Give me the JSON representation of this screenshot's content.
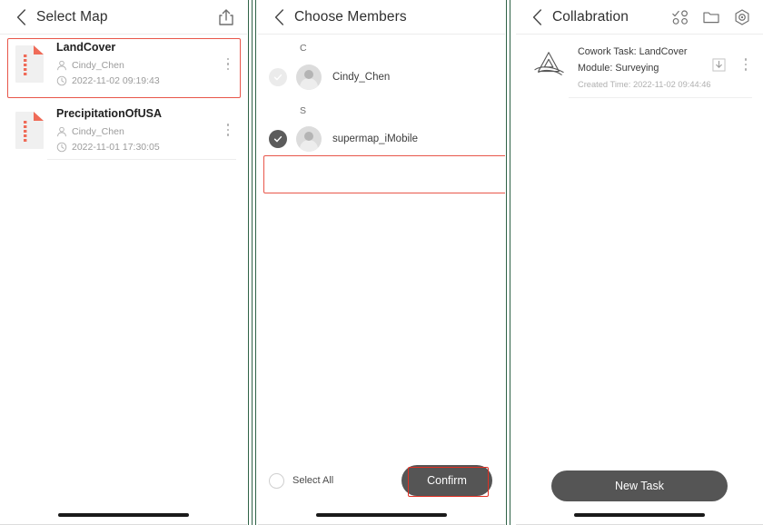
{
  "panel_select_map": {
    "header": {
      "back_icon": "chevron-left-icon",
      "title": "Select Map",
      "share_icon": "share-icon"
    },
    "maps": [
      {
        "name": "LandCover",
        "owner": "Cindy_Chen",
        "time": "2022-11-02 09:19:43",
        "file_icon": "zip-file-icon",
        "owner_icon": "person-icon",
        "time_icon": "clock-icon",
        "menu_icon": "more-vertical-icon",
        "highlighted": true
      },
      {
        "name": "PrecipitationOfUSA",
        "owner": "Cindy_Chen",
        "time": "2022-11-01 17:30:05",
        "file_icon": "zip-file-icon",
        "owner_icon": "person-icon",
        "time_icon": "clock-icon",
        "menu_icon": "more-vertical-icon",
        "highlighted": false
      }
    ]
  },
  "panel_choose_members": {
    "header": {
      "back_icon": "chevron-left-icon",
      "title": "Choose Members"
    },
    "sections": [
      {
        "letter": "C",
        "members": [
          {
            "name": "Cindy_Chen",
            "checked": false,
            "avatar_icon": "avatar-icon",
            "checkbox_icon": "check-circle-icon"
          }
        ]
      },
      {
        "letter": "S",
        "members": [
          {
            "name": "supermap_iMobile",
            "checked": true,
            "avatar_icon": "avatar-icon",
            "checkbox_icon": "check-circle-icon"
          }
        ]
      }
    ],
    "footer": {
      "select_all_label": "Select All",
      "select_all_checked": false,
      "confirm_label": "Confirm"
    }
  },
  "panel_collaboration": {
    "header": {
      "back_icon": "chevron-left-icon",
      "title": "Collabration",
      "actions": [
        "task-grid-icon",
        "folder-icon",
        "hex-settings-icon"
      ]
    },
    "tasks": [
      {
        "logo_icon": "mountain-logo-icon",
        "task_line": "Cowork Task: LandCover",
        "module_line": "Module: Surveying",
        "created_time": "Created Time: 2022-11-02 09:44:46",
        "download_icon": "download-icon",
        "menu_icon": "more-vertical-icon"
      }
    ],
    "footer": {
      "new_task_label": "New Task"
    }
  },
  "colors": {
    "highlight_red": "#e8564a",
    "confirm_highlight_red": "#e02f22",
    "button_dark": "#555555",
    "divider_green": "#2f6247",
    "file_accent": "#ef6b58"
  }
}
